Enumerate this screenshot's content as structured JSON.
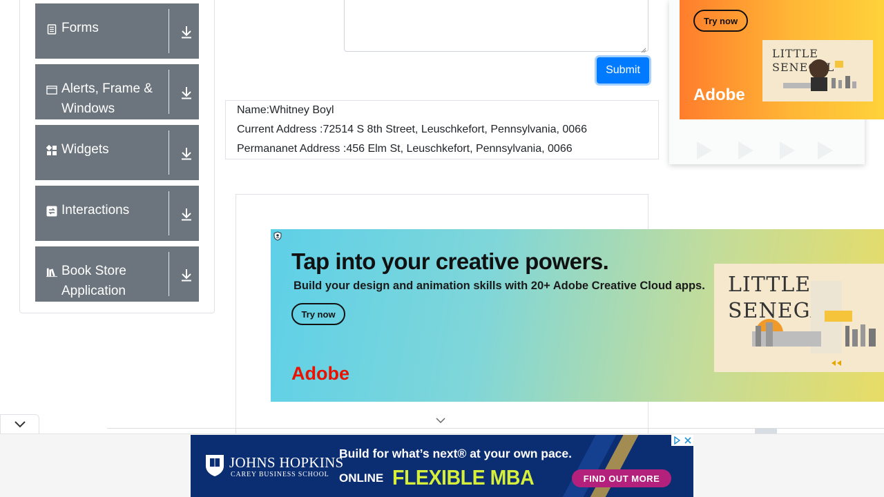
{
  "sidebar": {
    "groups": [
      {
        "label": "Forms",
        "icon": "form-icon"
      },
      {
        "label": "Alerts, Frame & Windows",
        "icon": "window-icon"
      },
      {
        "label": "Widgets",
        "icon": "widgets-icon"
      },
      {
        "label": "Interactions",
        "icon": "interactions-icon"
      },
      {
        "label": "Book Store Application",
        "icon": "books-icon"
      }
    ],
    "download_icon": "download-icon"
  },
  "form": {
    "textarea_value": "",
    "submit_label": "Submit"
  },
  "output": {
    "name": "Name:Whitney Boyl",
    "current_address": "Current Address :72514 S 8th Street, Leuschkefort, Pennsylvania, 0066",
    "permanent_address": "Permananet Address :456 Elm St, Leuschkefort, Pennsylvania, 0066"
  },
  "right_ad": {
    "cta": "Try now",
    "brand": "Adobe",
    "poster_title_1": "LITTLE",
    "poster_title_2": "SENEGAL"
  },
  "big_ad": {
    "headline": "Tap into your creative powers.",
    "subline": "Build your design and animation skills with 20+ Adobe Creative Cloud apps.",
    "cta": "Try now",
    "brand": "Adobe",
    "poster_title_1": "LITTLE",
    "poster_title_2": "SENEGAL"
  },
  "bottom_ad": {
    "school_name": "JOHNS HOPKINS",
    "school_sub": "CAREY BUSINESS SCHOOL",
    "line1": "Build for what’s next® at your own pace.",
    "online": "ONLINE",
    "program": "FLEXIBLE MBA",
    "cta": "FIND OUT MORE"
  },
  "colors": {
    "sidebar_header": "#6c757d",
    "submit": "#007bff",
    "adobe_red": "#eb1000",
    "mba_green": "#d6ef3a",
    "cta_magenta": "#b3217d"
  }
}
